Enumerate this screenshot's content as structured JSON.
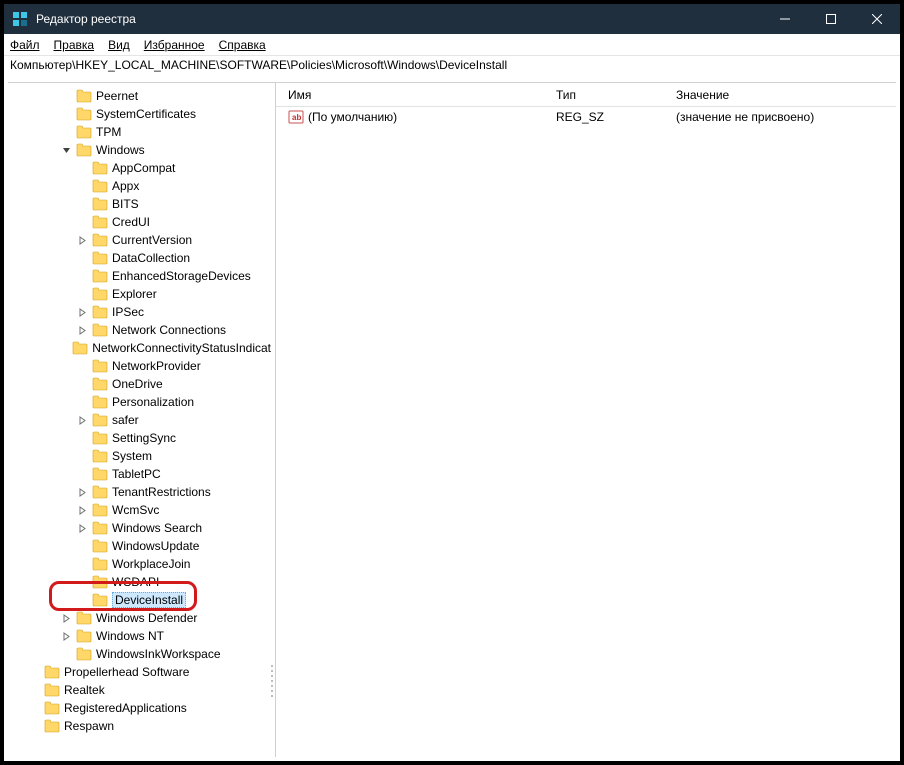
{
  "window": {
    "title": "Редактор реестра",
    "minimize_icon": "minimize",
    "maximize_icon": "maximize",
    "close_icon": "close"
  },
  "menubar": {
    "file": "Файл",
    "edit": "Правка",
    "view": "Вид",
    "favorites": "Избранное",
    "help": "Справка"
  },
  "addressbar": "Компьютер\\HKEY_LOCAL_MACHINE\\SOFTWARE\\Policies\\Microsoft\\Windows\\DeviceInstall",
  "tree": [
    {
      "indent": 3,
      "twisty": "",
      "label": "Peernet"
    },
    {
      "indent": 3,
      "twisty": "",
      "label": "SystemCertificates"
    },
    {
      "indent": 3,
      "twisty": "",
      "label": "TPM"
    },
    {
      "indent": 3,
      "twisty": "v",
      "label": "Windows"
    },
    {
      "indent": 4,
      "twisty": "",
      "label": "AppCompat"
    },
    {
      "indent": 4,
      "twisty": "",
      "label": "Appx"
    },
    {
      "indent": 4,
      "twisty": "",
      "label": "BITS"
    },
    {
      "indent": 4,
      "twisty": "",
      "label": "CredUI"
    },
    {
      "indent": 4,
      "twisty": ">",
      "label": "CurrentVersion"
    },
    {
      "indent": 4,
      "twisty": "",
      "label": "DataCollection"
    },
    {
      "indent": 4,
      "twisty": "",
      "label": "EnhancedStorageDevices"
    },
    {
      "indent": 4,
      "twisty": "",
      "label": "Explorer"
    },
    {
      "indent": 4,
      "twisty": ">",
      "label": "IPSec"
    },
    {
      "indent": 4,
      "twisty": ">",
      "label": "Network Connections"
    },
    {
      "indent": 4,
      "twisty": "",
      "label": "NetworkConnectivityStatusIndicat"
    },
    {
      "indent": 4,
      "twisty": "",
      "label": "NetworkProvider"
    },
    {
      "indent": 4,
      "twisty": "",
      "label": "OneDrive"
    },
    {
      "indent": 4,
      "twisty": "",
      "label": "Personalization"
    },
    {
      "indent": 4,
      "twisty": ">",
      "label": "safer"
    },
    {
      "indent": 4,
      "twisty": "",
      "label": "SettingSync"
    },
    {
      "indent": 4,
      "twisty": "",
      "label": "System"
    },
    {
      "indent": 4,
      "twisty": "",
      "label": "TabletPC"
    },
    {
      "indent": 4,
      "twisty": ">",
      "label": "TenantRestrictions"
    },
    {
      "indent": 4,
      "twisty": ">",
      "label": "WcmSvc"
    },
    {
      "indent": 4,
      "twisty": ">",
      "label": "Windows Search"
    },
    {
      "indent": 4,
      "twisty": "",
      "label": "WindowsUpdate"
    },
    {
      "indent": 4,
      "twisty": "",
      "label": "WorkplaceJoin"
    },
    {
      "indent": 4,
      "twisty": "",
      "label": "WSDAPI"
    },
    {
      "indent": 4,
      "twisty": "",
      "label": "DeviceInstall",
      "selected": true
    },
    {
      "indent": 3,
      "twisty": ">",
      "label": "Windows Defender"
    },
    {
      "indent": 3,
      "twisty": ">",
      "label": "Windows NT"
    },
    {
      "indent": 3,
      "twisty": "",
      "label": "WindowsInkWorkspace"
    },
    {
      "indent": 1,
      "twisty": "",
      "label": "Propellerhead Software"
    },
    {
      "indent": 1,
      "twisty": "",
      "label": "Realtek"
    },
    {
      "indent": 1,
      "twisty": "",
      "label": "RegisteredApplications"
    },
    {
      "indent": 1,
      "twisty": "",
      "label": "Respawn"
    }
  ],
  "list": {
    "columns": {
      "name": "Имя",
      "type": "Тип",
      "value": "Значение"
    },
    "rows": [
      {
        "name": "(По умолчанию)",
        "type": "REG_SZ",
        "value": "(значение не присвоено)"
      }
    ]
  }
}
